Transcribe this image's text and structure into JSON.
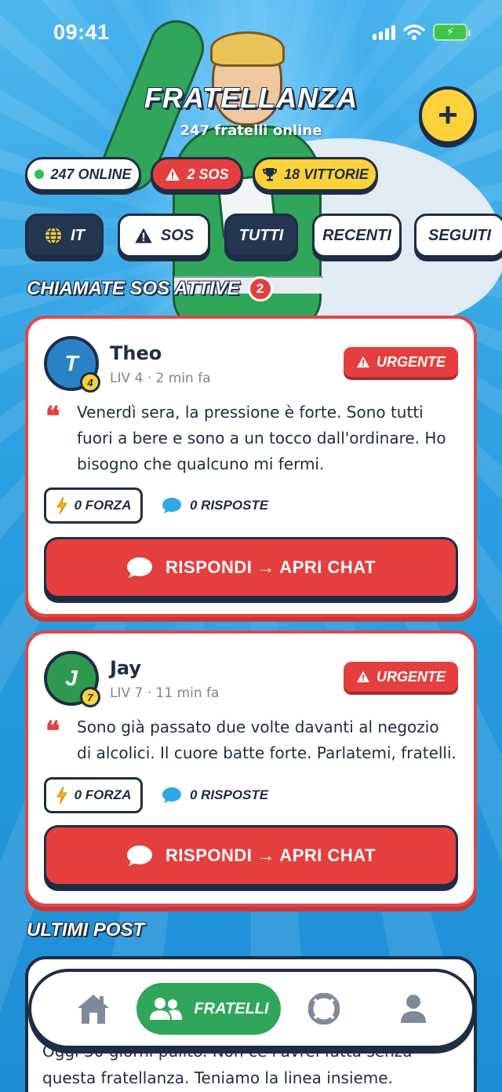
{
  "status_bar": {
    "time": "09:41"
  },
  "header": {
    "title": "FRATELLANZA",
    "subtitle": "247 fratelli online",
    "add_label": "+"
  },
  "stats": {
    "online": "247 ONLINE",
    "sos": "2 SOS",
    "wins": "18 VITTORIE"
  },
  "filters": [
    {
      "label": "IT",
      "icon": "globe-icon",
      "active": true
    },
    {
      "label": "SOS",
      "icon": "warning-icon",
      "active": false
    },
    {
      "label": "TUTTI",
      "active": true
    },
    {
      "label": "RECENTI",
      "active": false
    },
    {
      "label": "SEGUITI",
      "active": false
    }
  ],
  "sos_section": {
    "title": "CHIAMATE SOS ATTIVE",
    "count": "2"
  },
  "sos_calls": [
    {
      "initial": "T",
      "level": "4",
      "name": "Theo",
      "meta": "LIV 4 · 2 min fa",
      "badge": "URGENTE",
      "message": "Venerdì sera, la pressione è forte. Sono tutti fuori a bere e sono a un tocco dall'ordinare. Ho bisogno che qualcuno mi fermi.",
      "force": "0 FORZA",
      "replies": "0 RISPOSTE",
      "action": "RISPONDI → APRI CHAT",
      "avatar_color": "#2a82c6"
    },
    {
      "initial": "J",
      "level": "7",
      "name": "Jay",
      "meta": "LIV 7 · 11 min fa",
      "badge": "URGENTE",
      "message": "Sono già passato due volte davanti al negozio di alcolici. Il cuore batte forte. Parlatemi, fratelli.",
      "force": "0 FORZA",
      "replies": "0 RISPOSTE",
      "action": "RISPONDI → APRI CHAT",
      "avatar_color": "#2f9a4e"
    }
  ],
  "latest_section": {
    "title": "ULTIMI POST"
  },
  "latest_post": {
    "text": "Oggi 30 giorni pulito. Non ce l'avrei fatta senza questa fratellanza. Teniamo la linea insieme."
  },
  "bottom_nav": {
    "home_icon": "home-icon",
    "fratelli_label": "FRATELLI",
    "help_icon": "lifebuoy-icon",
    "profile_icon": "user-icon"
  },
  "colors": {
    "red": "#e53e3e",
    "navy": "#1e2d45",
    "yellow": "#fbd23a",
    "green": "#2fa65a",
    "sky": "#2a9ee0"
  }
}
